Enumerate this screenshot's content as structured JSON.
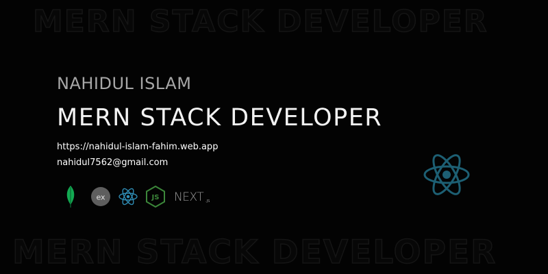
{
  "watermark": {
    "top_text": "MERN STACK DEVELOPER",
    "bottom_text": "MERN STACK DEVELOPER"
  },
  "profile": {
    "name": "NAHIDUL ISLAM",
    "role": "MERN STACK DEVELOPER",
    "website": "https://nahidul-islam-fahim.web.app",
    "email": "nahidul7562@gmail.com"
  },
  "tech_stack": {
    "items": [
      {
        "name": "MongoDB",
        "icon": "mongodb-leaf-icon"
      },
      {
        "name": "Express",
        "icon": "express-icon",
        "label": "ex"
      },
      {
        "name": "React",
        "icon": "react-icon"
      },
      {
        "name": "Node.js",
        "icon": "nodejs-icon",
        "label": "JS"
      },
      {
        "name": "Next.js",
        "icon": "nextjs-icon",
        "label": "NEXT",
        "suffix": ".JS"
      }
    ]
  },
  "colors": {
    "background": "#030303",
    "name_text": "#a7a7a7",
    "role_text": "#f2f2f2",
    "mongodb_green": "#13aa52",
    "express_gray": "#666666",
    "react_blue": "#2f8cb4",
    "node_green": "#3c873a",
    "big_react": "#1d5f73"
  }
}
